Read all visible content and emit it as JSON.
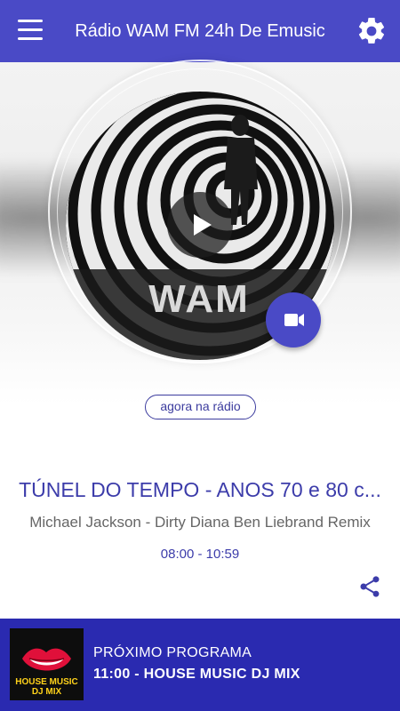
{
  "appbar": {
    "title": "Rádio WAM FM 24h De Emusic",
    "menu_icon": "menu-icon",
    "settings_icon": "gear-icon",
    "color": "#4a4ac6"
  },
  "hero": {
    "cover_logo_text": "WAM",
    "play_icon": "play-icon",
    "video_icon": "video-camera-icon",
    "now_label": "agora na rádio"
  },
  "program": {
    "title": "TÚNEL DO TEMPO - ANOS 70 e 80 c...",
    "track": "Michael Jackson - Dirty Diana Ben Liebrand Remix",
    "time": "08:00 - 10:59",
    "share_icon": "share-icon"
  },
  "next": {
    "label": "PRÓXIMO PROGRAMA",
    "name": "11:00 - HOUSE MUSIC DJ MIX",
    "thumb_line1": "HOUSE MUSIC",
    "thumb_line2": "DJ MIX",
    "color": "#2a2ab0"
  }
}
